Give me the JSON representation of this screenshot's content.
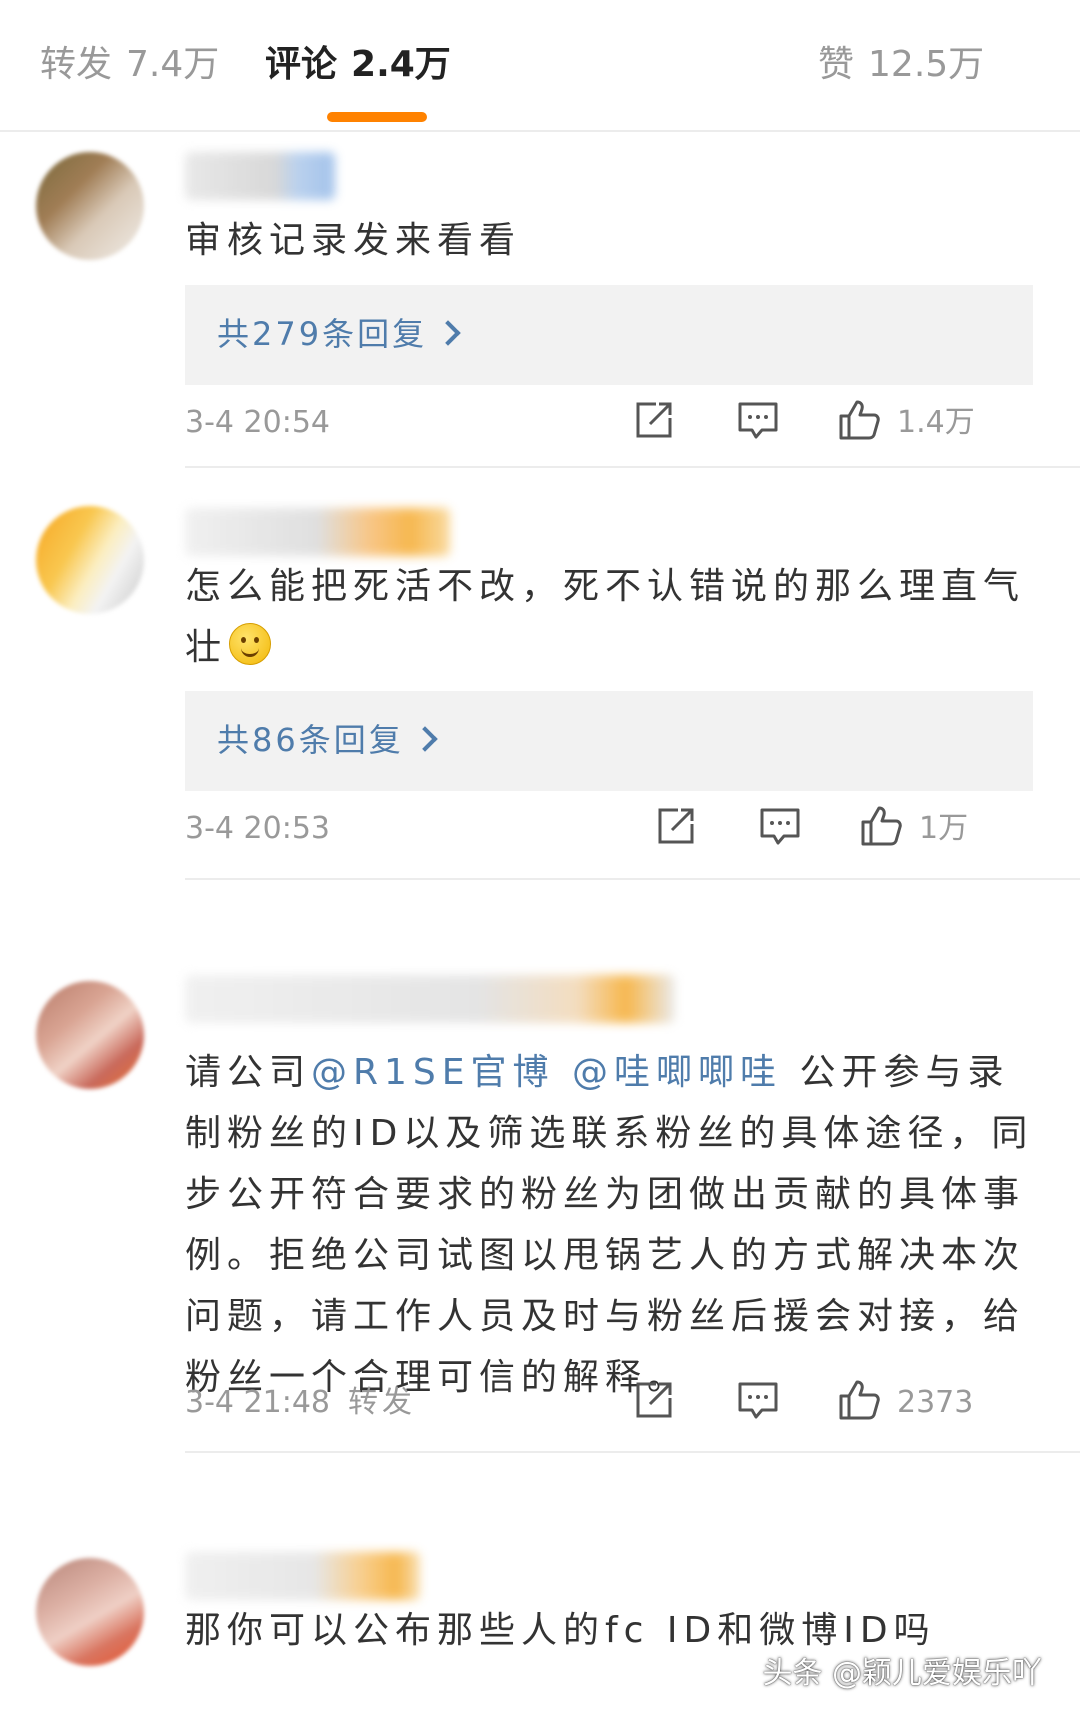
{
  "tabs": [
    {
      "label": "转发",
      "count": "7.4万"
    },
    {
      "label": "评论",
      "count": "2.4万"
    },
    {
      "label": "赞",
      "count": "12.5万"
    }
  ],
  "active_tab": "评论",
  "accent_color": "#ff8200",
  "link_color": "#4f7cab",
  "icons": {
    "share": "share-square-icon",
    "comment": "comment-bubble-icon",
    "like": "thumbs-up-icon"
  },
  "comments": [
    {
      "text": "审核记录发来看看",
      "replies": "共279条回复",
      "time": "3-4 20:54",
      "likes": "1.4万"
    },
    {
      "text": "怎么能把死活不改，死不认错说的那么理直气壮",
      "replies": "共86条回复",
      "time": "3-4 20:53",
      "likes": "1万"
    },
    {
      "prefix": "请公司",
      "mention1": "@R1SE官博",
      "mention2": "@哇唧唧哇",
      "text": "公开参与录制粉丝的ID以及筛选联系粉丝的具体途径，同步公开符合要求的粉丝为团做出贡献的具体事例。拒绝公司试图以甩锅艺人的方式解决本次问题，请工作人员及时与粉丝后援会对接，给粉丝一个合理可信的解释。",
      "time": "3-4 21:48",
      "forward": "转发",
      "likes": "2373"
    },
    {
      "text": "那你可以公布那些人的fc ID和微博ID吗"
    }
  ],
  "watermark": "头条 @颖儿爱娱乐吖"
}
